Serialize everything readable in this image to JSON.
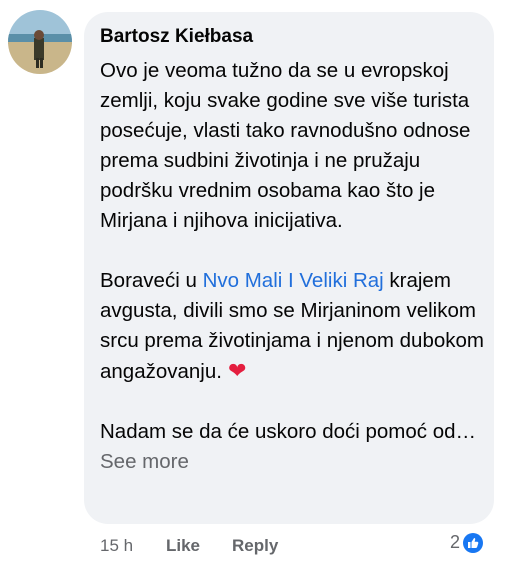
{
  "comment": {
    "author": "Bartosz Kiełbasa",
    "paragraph1": "Ovo je veoma tužno da se u evropskoj zemlji, koju svake godine sve više turista posećuje, vlasti tako ravnodušno odnose prema sudbini životinja i ne pružaju podršku vrednim osobama kao što je Mirjana i njihova inicijativa.",
    "paragraph2_before": "Boraveći u ",
    "paragraph2_link": "Nvo Mali I Veliki Raj",
    "paragraph2_after": " krajem avgusta, divili smo se Mirjaninom velikom srcu prema životinjama i njenom dubokom angažovanju.",
    "paragraph3": "Nadam se da će uskoro doći pomoć od…",
    "see_more": "See more"
  },
  "actions": {
    "timestamp": "15 h",
    "like": "Like",
    "reply": "Reply",
    "reaction_count": "2"
  },
  "icons": {
    "heart": "heart-emoji-icon",
    "like_badge": "like-thumb-icon"
  },
  "colors": {
    "link": "#216fdb",
    "bubble": "#f0f2f5",
    "like_badge": "#1877f2",
    "heart": "#e41e3f"
  }
}
